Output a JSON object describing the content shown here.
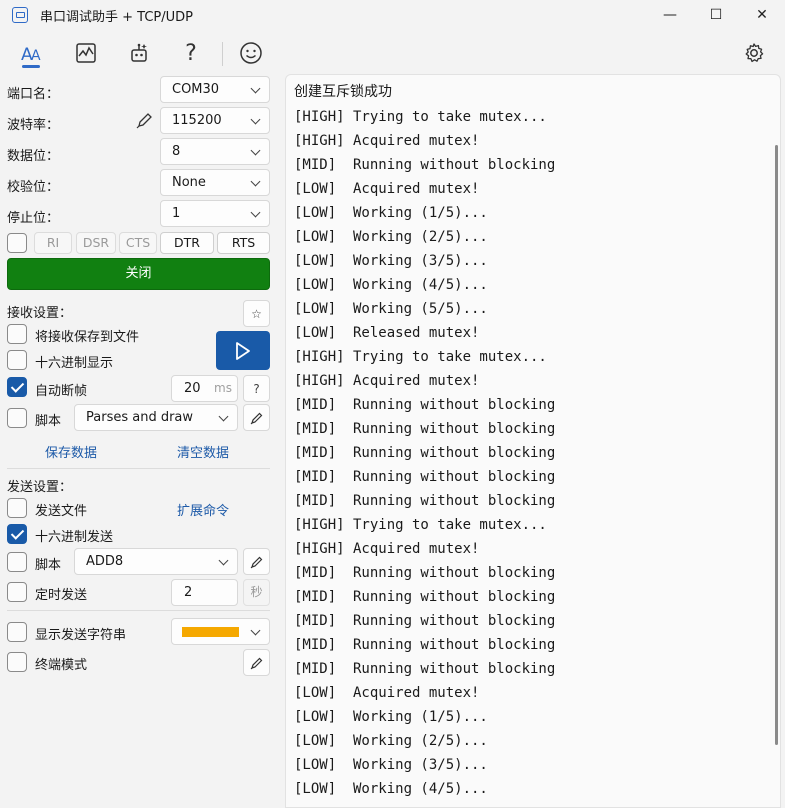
{
  "window": {
    "title": "串口调试助手 + TCP/UDP",
    "minimize": "—",
    "maximize": "☐",
    "close": "✕"
  },
  "toolbar": {
    "items": [
      "text-format-icon",
      "chart-icon",
      "robot-icon",
      "help-icon",
      "emoji-icon"
    ],
    "settings": "gear-icon"
  },
  "serial": {
    "port_label": "端口名：",
    "port_value": "COM30",
    "baud_label": "波特率：",
    "baud_value": "115200",
    "databits_label": "数据位：",
    "databits_value": "8",
    "parity_label": "校验位：",
    "parity_value": "None",
    "stopbits_label": "停止位：",
    "stopbits_value": "1",
    "signals": [
      "RI",
      "DSR",
      "CTS",
      "DTR",
      "RTS"
    ],
    "close_label": "关闭"
  },
  "receive": {
    "title": "接收设置：",
    "save_to_file": "将接收保存到文件",
    "hex_display": "十六进制显示",
    "auto_frame": "自动断帧",
    "frame_ms_value": "20",
    "frame_ms_unit": "ms",
    "help": "?",
    "script_label": "脚本",
    "script_value": "Parses and draw",
    "save_data": "保存数据",
    "clear_data": "清空数据",
    "auto_frame_checked": true
  },
  "send": {
    "title": "发送设置：",
    "send_file": "发送文件",
    "extend_cmd": "扩展命令",
    "hex_send": "十六进制发送",
    "hex_send_checked": true,
    "script_label": "脚本",
    "script_value": "ADD8",
    "timed_send": "定时发送",
    "timed_value": "2",
    "timed_unit": "秒",
    "show_string": "显示发送字符串",
    "string_color": "#f5a800",
    "terminal_mode": "终端模式"
  },
  "log": {
    "header": "创建互斥锁成功",
    "lines": [
      "[HIGH] Trying to take mutex...",
      "[HIGH] Acquired mutex!",
      "[MID]  Running without blocking",
      "[LOW]  Acquired mutex!",
      "[LOW]  Working (1/5)...",
      "[LOW]  Working (2/5)...",
      "[LOW]  Working (3/5)...",
      "[LOW]  Working (4/5)...",
      "[LOW]  Working (5/5)...",
      "[LOW]  Released mutex!",
      "[HIGH] Trying to take mutex...",
      "[HIGH] Acquired mutex!",
      "[MID]  Running without blocking",
      "[MID]  Running without blocking",
      "[MID]  Running without blocking",
      "[MID]  Running without blocking",
      "[MID]  Running without blocking",
      "[HIGH] Trying to take mutex...",
      "[HIGH] Acquired mutex!",
      "[MID]  Running without blocking",
      "[MID]  Running without blocking",
      "[MID]  Running without blocking",
      "[MID]  Running without blocking",
      "[MID]  Running without blocking",
      "[LOW]  Acquired mutex!",
      "[LOW]  Working (1/5)...",
      "[LOW]  Working (2/5)...",
      "[LOW]  Working (3/5)...",
      "[LOW]  Working (4/5)..."
    ]
  }
}
